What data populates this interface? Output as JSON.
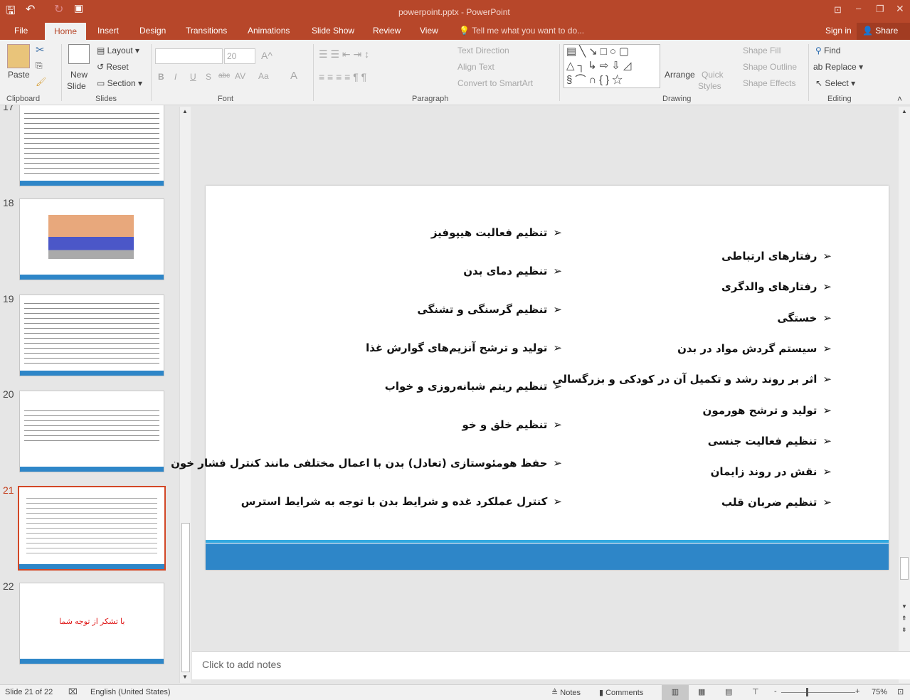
{
  "titlebar": {
    "title": "powerpoint.pptx - PowerPoint"
  },
  "tabs": [
    "File",
    "Home",
    "Insert",
    "Design",
    "Transitions",
    "Animations",
    "Slide Show",
    "Review",
    "View"
  ],
  "tell_me": "Tell me what you want to do...",
  "sign_in": "Sign in",
  "share": "Share",
  "ribbon": {
    "clipboard": {
      "paste": "Paste",
      "label": "Clipboard"
    },
    "slides": {
      "new_slide": "New",
      "new_slide2": "Slide",
      "layout": "Layout",
      "reset": "Reset",
      "section": "Section",
      "label": "Slides"
    },
    "font": {
      "size": "20",
      "label": "Font",
      "bold": "B",
      "italic": "I",
      "underline": "U",
      "shadow": "S",
      "strike": "abc",
      "spacing": "AV",
      "case": "Aa",
      "color": "A"
    },
    "paragraph": {
      "text_direction": "Text Direction",
      "align_text": "Align Text",
      "smartart": "Convert to SmartArt",
      "label": "Paragraph"
    },
    "drawing": {
      "arrange": "Arrange",
      "quick": "Quick",
      "styles": "Styles",
      "fill": "Shape Fill",
      "outline": "Shape Outline",
      "effects": "Shape Effects",
      "label": "Drawing"
    },
    "editing": {
      "find": "Find",
      "replace": "Replace",
      "select": "Select",
      "label": "Editing"
    }
  },
  "thumbnails": [
    {
      "num": "17"
    },
    {
      "num": "18"
    },
    {
      "num": "19"
    },
    {
      "num": "20"
    },
    {
      "num": "21",
      "selected": true
    },
    {
      "num": "22",
      "text": "با تشکر از توجه شما"
    }
  ],
  "slide": {
    "right": [
      "رفتارهای ارتباطی",
      "رفتارهای والدگری",
      "خستگی",
      "سیستم گردش مواد در بدن",
      "اثر بر روند رشد و تکمیل آن در کودکی و بزرگسالی",
      "تولید و ترشح هورمون",
      "تنظیم فعالیت جنسی",
      "نقش در روند زایمان",
      "تنظیم ضربان قلب"
    ],
    "left": [
      "تنظیم فعالیت هیپوفیز",
      "تنظیم دمای بدن",
      "تنظیم گرسنگی و تشنگی",
      "تولید و ترشح آنزیم‌های گوارش غذا",
      "تنظیم ریتم شبانه‌روزی و خواب",
      "تنظیم خلق و خو",
      "حفظ هومئوستازی (تعادل) بدن با اعمال مختلفی مانند کنترل فشار خون",
      "کنترل عملکرد غده و شرایط بدن با توجه به شرایط استرس"
    ],
    "bullet": "➢",
    "accent": "#2e86c8"
  },
  "notes_placeholder": "Click to add notes",
  "status": {
    "slide": "Slide 21 of 22",
    "language": "English (United States)",
    "notes": "Notes",
    "comments": "Comments",
    "zoom": "75%"
  }
}
